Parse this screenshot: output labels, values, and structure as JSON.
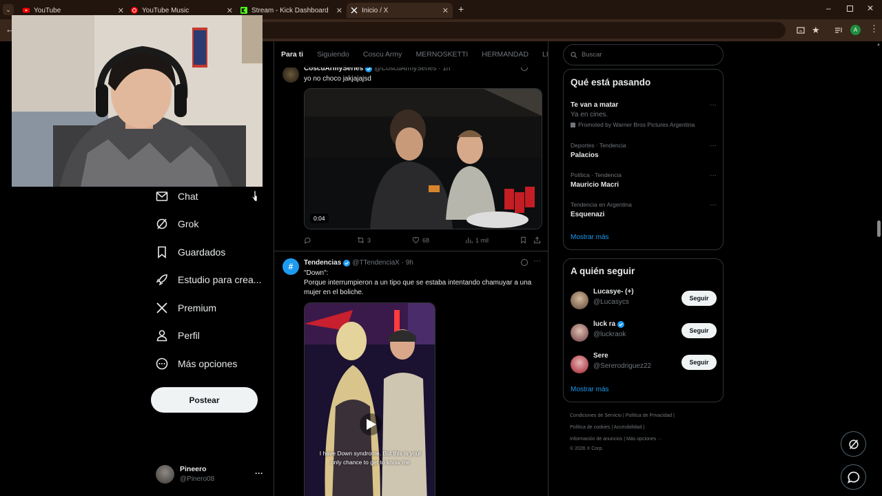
{
  "browser": {
    "tabs": [
      {
        "title": "YouTube"
      },
      {
        "title": "YouTube Music"
      },
      {
        "title": "Stream - Kick Dashboard"
      },
      {
        "title": "Inicio / X"
      }
    ],
    "new_tab": "+",
    "profile_initial": "A"
  },
  "nav": {
    "items": [
      {
        "label": "Chat",
        "icon": "mail-icon"
      },
      {
        "label": "Grok",
        "icon": "grok-icon"
      },
      {
        "label": "Guardados",
        "icon": "bookmark-icon"
      },
      {
        "label": "Estudio para crea...",
        "icon": "rocket-icon"
      },
      {
        "label": "Premium",
        "icon": "x-logo-icon"
      },
      {
        "label": "Perfil",
        "icon": "person-icon"
      },
      {
        "label": "Más opciones",
        "icon": "more-circle-icon"
      }
    ],
    "post_button": "Postear",
    "account": {
      "name": "Pineero",
      "handle": "@Pinero08",
      "more": "···"
    }
  },
  "timeline": {
    "tabs": [
      "Para ti",
      "Siguiendo",
      "Coscu Army",
      "MERNOSKETTI",
      "HERMANDAD",
      "LIEBI"
    ],
    "tweets": [
      {
        "name": "CoscuArmySeries",
        "handle": "@CoscuArmySeries · 1h",
        "text": "yo no choco jakjajajsd",
        "video_time": "0:04",
        "retweets": "3",
        "likes": "68",
        "views": "1 mil"
      },
      {
        "name": "Tendencias",
        "handle": "@TTendenciaX · 9h",
        "text_lines": [
          "\"Down\":",
          "Porque interrumpieron a un tipo que se estaba intentando chamuyar a una",
          "mujer en el boliche."
        ],
        "caption_lines": [
          "I have Down syndrome. But this is your",
          "only chance to get to know me"
        ]
      }
    ]
  },
  "sidebar": {
    "search_placeholder": "Buscar",
    "trends_title": "Qué está pasando",
    "trends": [
      {
        "name": "Te van a matar",
        "sub": "Ya en cines.",
        "promo": "Promoted by Warner Bros Pictures Argentina"
      },
      {
        "context": "Deportes · Tendencia",
        "name": "Palacios"
      },
      {
        "context": "Política · Tendencia",
        "name": "Mauricio Macri"
      },
      {
        "context": "Tendencia en Argentina",
        "name": "Esquenazi"
      }
    ],
    "trends_more": "Mostrar más",
    "follow_title": "A quién seguir",
    "follow": [
      {
        "name": "Lucasye- (+)",
        "handle": "@Lucasycs",
        "button": "Seguir"
      },
      {
        "name": "luck ra",
        "handle": "@luckraok",
        "button": "Seguir"
      },
      {
        "name": "Sere",
        "handle": "@Sererodriguez22",
        "button": "Seguir"
      }
    ],
    "follow_more": "Mostrar más",
    "footer": {
      "links": [
        "Condiciones de Servicio",
        "Política de Privacidad",
        "Política de cookies",
        "Accesibilidad",
        "Información de anuncios",
        "Más opciones ···"
      ],
      "copyright": "© 2026 X Corp."
    }
  },
  "colors": {
    "accent": "#1d9bf0",
    "background": "#000000",
    "browser_frame": "#22150e"
  }
}
